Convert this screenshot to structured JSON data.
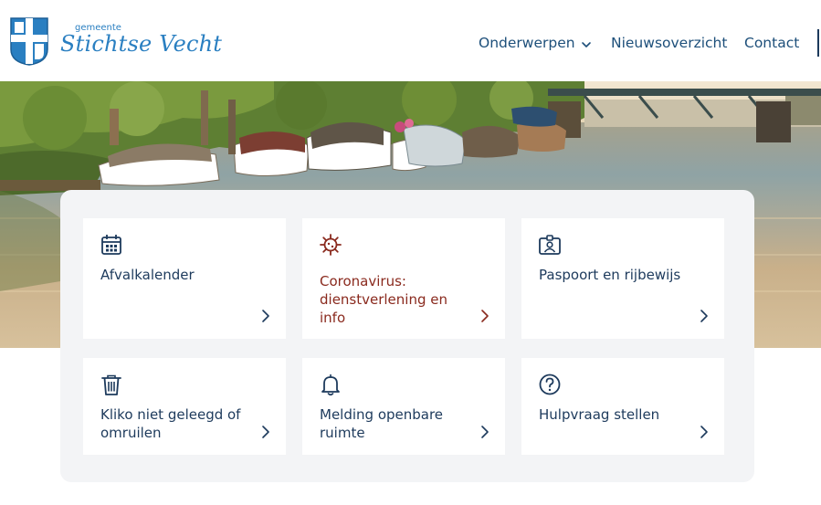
{
  "header": {
    "logo": {
      "small_text": "gemeente",
      "big_text": "Stichtse Vecht",
      "shield_icon": "coat-of-arms-icon"
    },
    "nav": {
      "onderwerpen_label": "Onderwerpen",
      "nieuws_label": "Nieuwsoverzicht",
      "contact_label": "Contact"
    }
  },
  "tiles": [
    {
      "label": "Afvalkalender",
      "icon": "calendar-icon",
      "highlight": false
    },
    {
      "label": "Coronavirus: dienstverlening en info",
      "icon": "virus-icon",
      "highlight": true
    },
    {
      "label": "Paspoort en rijbewijs",
      "icon": "id-card-icon",
      "highlight": false
    },
    {
      "label": "Kliko niet geleegd of omruilen",
      "icon": "trash-bin-icon",
      "highlight": false
    },
    {
      "label": "Melding openbare ruimte",
      "icon": "bell-icon",
      "highlight": false
    },
    {
      "label": "Hulpvraag stellen",
      "icon": "question-circle-icon",
      "highlight": false
    }
  ],
  "colors": {
    "primary": "#1d3a5c",
    "logo_blue": "#2a7fc1",
    "corona_red": "#8a2a1e",
    "panel_bg": "#f3f4f6"
  }
}
